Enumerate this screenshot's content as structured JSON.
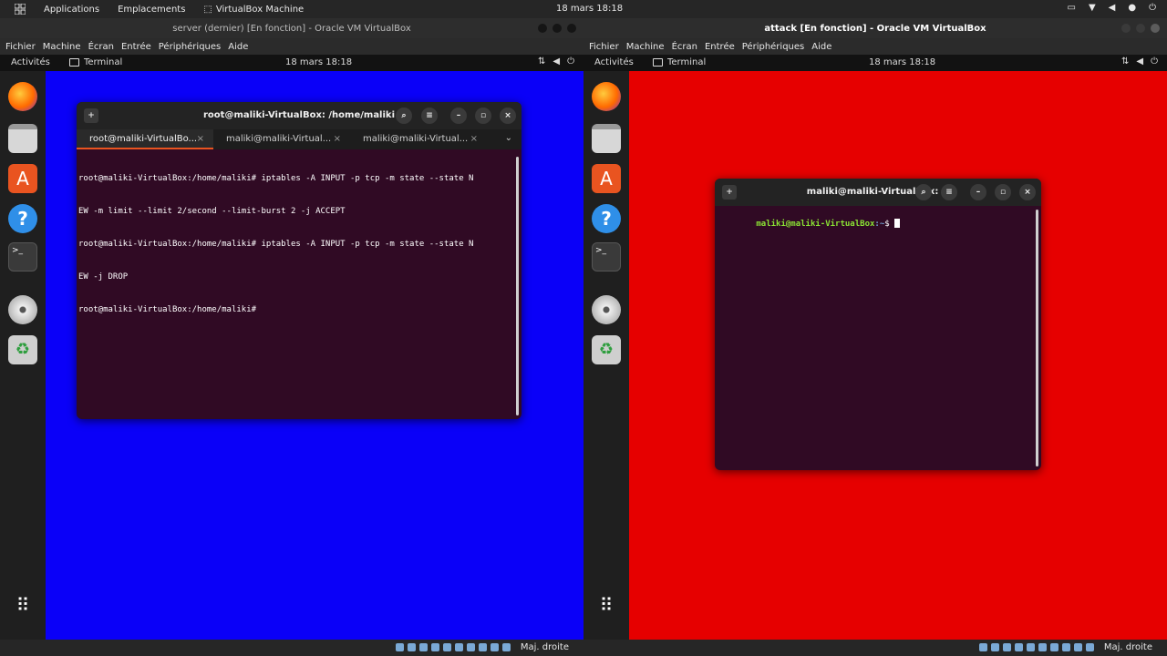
{
  "host_topbar": {
    "applications": "Applications",
    "places": "Emplacements",
    "active_app": "VirtualBox Machine",
    "clock": "18 mars  18:18"
  },
  "left_vm": {
    "title": "server (dernier) [En fonction] - Oracle VM VirtualBox",
    "menu": [
      "Fichier",
      "Machine",
      "Écran",
      "Entrée",
      "Périphériques",
      "Aide"
    ],
    "guest_topbar": {
      "activities": "Activités",
      "app": "Terminal",
      "clock": "18 mars  18:18"
    },
    "desktop_color": "#0a00f8",
    "terminal": {
      "title": "root@maliki-VirtualBox: /home/maliki",
      "tabs": [
        "root@maliki-VirtualBo...",
        "maliki@maliki-Virtual...",
        "maliki@maliki-Virtual..."
      ],
      "lines": [
        "root@maliki-VirtualBox:/home/maliki# iptables -A INPUT -p tcp -m state --state N",
        "EW -m limit --limit 2/second --limit-burst 2 -j ACCEPT",
        "root@maliki-VirtualBox:/home/maliki# iptables -A INPUT -p tcp -m state --state N",
        "EW -j DROP",
        "root@maliki-VirtualBox:/home/maliki#"
      ]
    },
    "status_hostkey": "Maj. droite"
  },
  "right_vm": {
    "title": "attack [En fonction] - Oracle VM VirtualBox",
    "menu": [
      "Fichier",
      "Machine",
      "Écran",
      "Entrée",
      "Périphériques",
      "Aide"
    ],
    "guest_topbar": {
      "activities": "Activités",
      "app": "Terminal",
      "clock": "18 mars  18:18"
    },
    "desktop_color": "#e60000",
    "terminal": {
      "title": "maliki@maliki-VirtualBox: ~",
      "prompt_user": "maliki@maliki-VirtualBox",
      "prompt_path": ":~",
      "prompt_symbol": "$ "
    },
    "status_hostkey": "Maj. droite"
  }
}
